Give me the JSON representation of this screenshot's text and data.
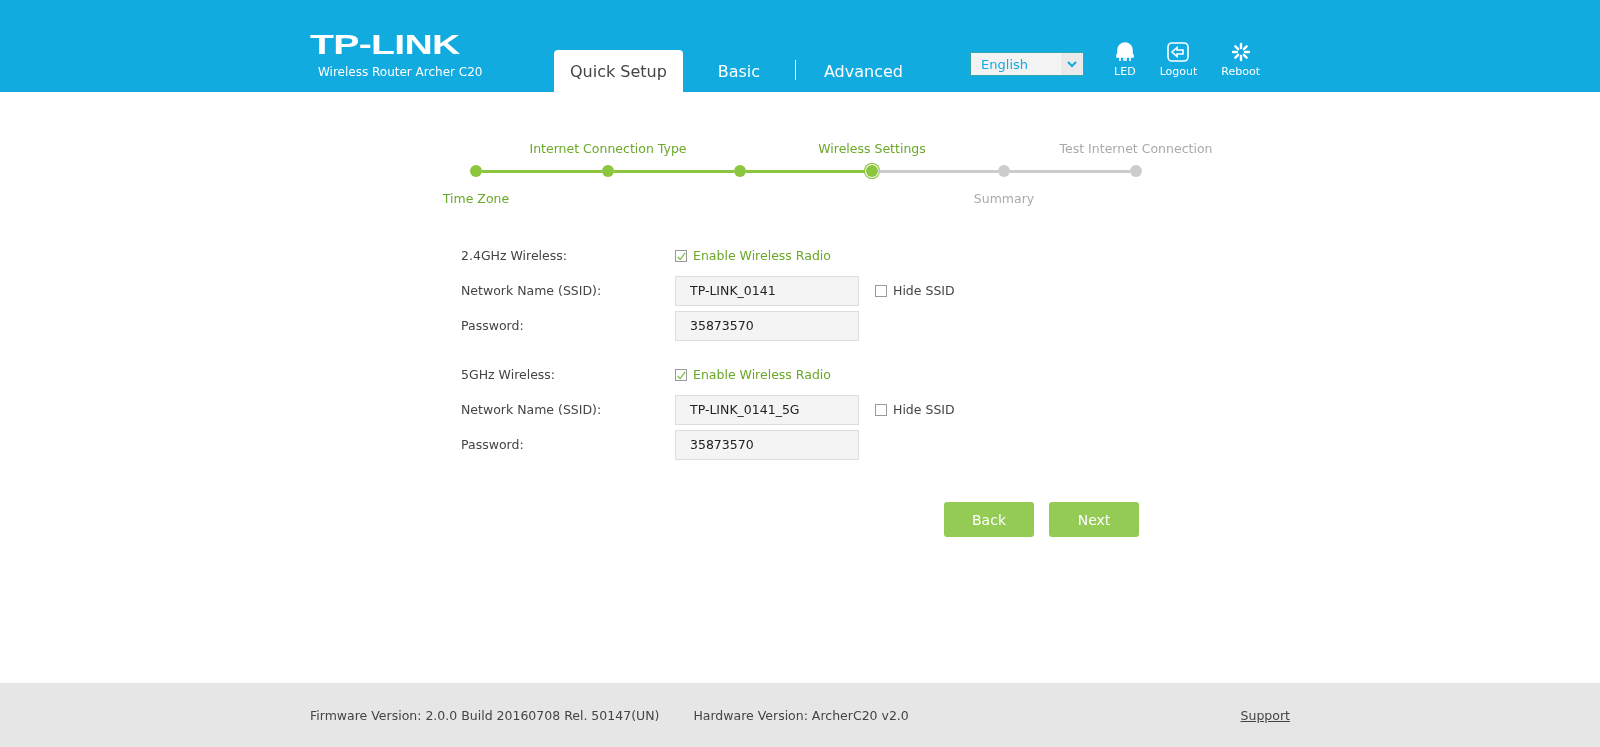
{
  "header": {
    "logo": "TP-LINK",
    "model": "Wireless Router Archer C20",
    "tabs": [
      {
        "label": "Quick Setup",
        "selected": true
      },
      {
        "label": "Basic",
        "selected": false
      },
      {
        "label": "Advanced",
        "selected": false
      }
    ],
    "language": "English",
    "tools": [
      {
        "kind": "led",
        "label": "LED"
      },
      {
        "kind": "logout",
        "label": "Logout"
      },
      {
        "kind": "reboot",
        "label": "Reboot"
      }
    ]
  },
  "steps": [
    {
      "label": "Time Zone",
      "reached": true,
      "current": false
    },
    {
      "label": "Internet Connection Type",
      "reached": true,
      "current": false
    },
    {
      "reached": true,
      "current": false
    },
    {
      "label": "Wireless Settings",
      "reached": true,
      "current": true
    },
    {
      "label": "Summary",
      "reached": false,
      "current": false
    },
    {
      "label": "Test Internet Connection",
      "reached": false,
      "current": false
    }
  ],
  "bands": [
    {
      "title": "2.4GHz Wireless:",
      "enable_label": "Enable Wireless Radio",
      "enabled": true,
      "ssid_label": "Network Name (SSID):",
      "ssid": "TP-LINK_0141",
      "hide_label": "Hide SSID",
      "hide_ssid": false,
      "password_label": "Password:",
      "password": "35873570"
    },
    {
      "title": "5GHz Wireless:",
      "enable_label": "Enable Wireless Radio",
      "enabled": true,
      "ssid_label": "Network Name (SSID):",
      "ssid": "TP-LINK_0141_5G",
      "hide_label": "Hide SSID",
      "hide_ssid": false,
      "password_label": "Password:",
      "password": "35873570"
    }
  ],
  "buttons": [
    "Back",
    "Next"
  ],
  "footer": {
    "firmware": "Firmware Version: 2.0.0 Build 20160708 Rel. 50147(UN)",
    "hardware": "Hardware Version: ArcherC20 v2.0",
    "support": "Support"
  }
}
